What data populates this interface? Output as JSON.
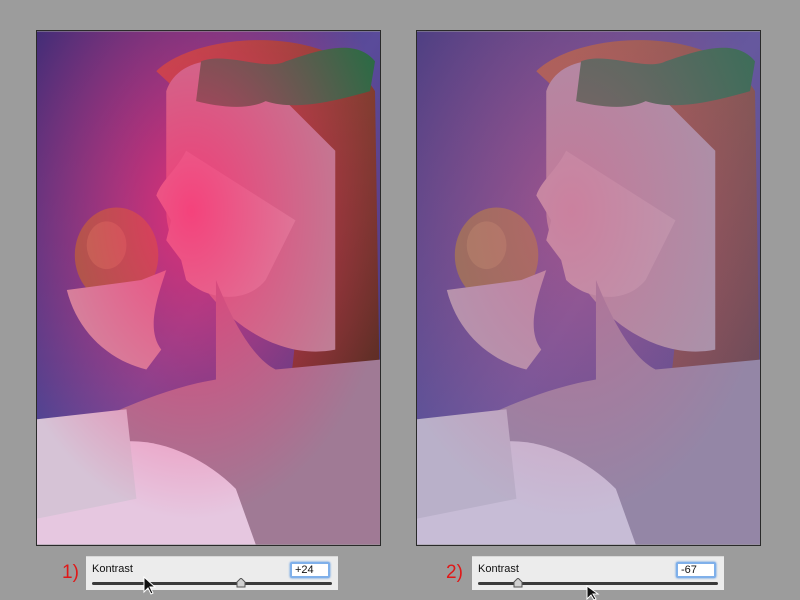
{
  "panels": [
    {
      "step": "1)",
      "slider": {
        "label": "Kontrast",
        "value": "+24",
        "level": 24
      }
    },
    {
      "step": "2)",
      "slider": {
        "label": "Kontrast",
        "value": "-67",
        "level": -67
      }
    }
  ],
  "colors": {
    "background": "#9c9c9c",
    "step_number": "#e01818",
    "field_focus": "#7fb0ea",
    "photo_backdrop": "#4b3a86",
    "magenta_light": "#ff2a6e"
  },
  "icons": [
    "pointer-cursor-icon",
    "slider-thumb-icon"
  ]
}
